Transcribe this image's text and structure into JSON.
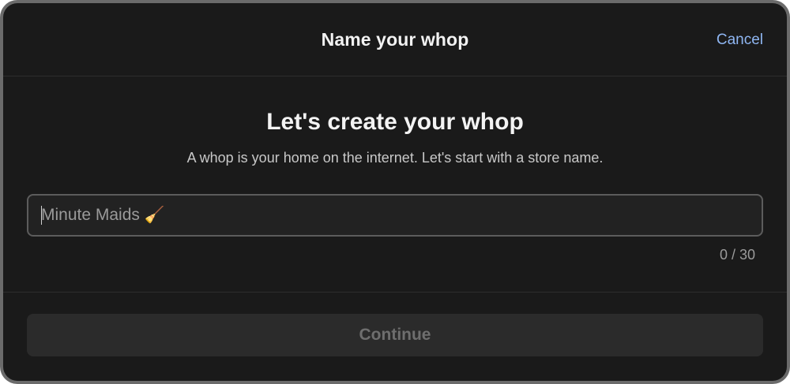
{
  "header": {
    "title": "Name your whop",
    "cancel_label": "Cancel"
  },
  "main": {
    "heading": "Let's create your whop",
    "subtitle": "A whop is your home on the internet. Let's start with a store name.",
    "store_name_input": {
      "value": "",
      "placeholder": "Minute Maids 🧹",
      "char_count": "0 / 30",
      "max_length": 30
    }
  },
  "footer": {
    "continue_label": "Continue"
  },
  "colors": {
    "background": "#1a1a1a",
    "accent_link": "#8fb6f2",
    "input_border": "#5c5c5c",
    "disabled_button_bg": "#2b2b2b",
    "disabled_button_text": "#6e6e6e"
  },
  "icons": []
}
